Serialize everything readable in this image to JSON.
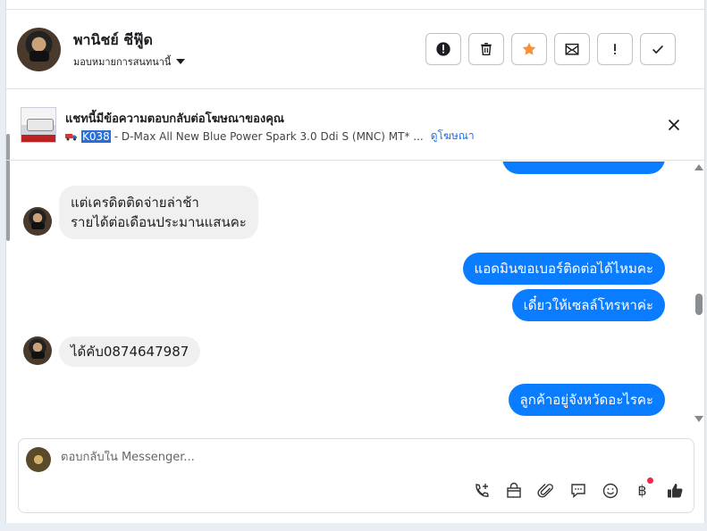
{
  "header": {
    "contact_name": "พานิชย์ ชีฟู๊ด",
    "assign_label": "มอบหมายการสนทนานี้"
  },
  "actions": [
    "spam",
    "delete",
    "star",
    "mark-unread",
    "important",
    "done"
  ],
  "ad_banner": {
    "title": "แชทนี้มีข้อความตอบกลับต่อโฆษณาของคุณ",
    "code": "K038",
    "description": " - D-Max All New Blue Power Spark 3.0 Ddi S (MNC) MT* ...",
    "link_label": "ดูโฆษณา"
  },
  "messages": [
    {
      "direction": "in",
      "lines": [
        "แต่เครดิตติดจ่ายล่าช้า",
        "รายได้ต่อเดือนประมานแสนคะ"
      ]
    },
    {
      "direction": "out",
      "text": "แอดมินขอเบอร์ติดต่อได้ไหมคะ"
    },
    {
      "direction": "out",
      "text": "เดี๋ยวให้เซลล์โทรหาค่ะ"
    },
    {
      "direction": "in",
      "text": "ได้คับ0874647987"
    },
    {
      "direction": "out",
      "text": "ลูกค้าอยู่จังหวัดอะไรคะ"
    }
  ],
  "composer": {
    "placeholder": "ตอบกลับใน Messenger...",
    "currency_symbol": "฿"
  },
  "colors": {
    "outgoing_bubble": "#0a7cff",
    "incoming_bubble": "#f0f0f0",
    "star": "#f7923a",
    "link": "#1a73e8"
  }
}
